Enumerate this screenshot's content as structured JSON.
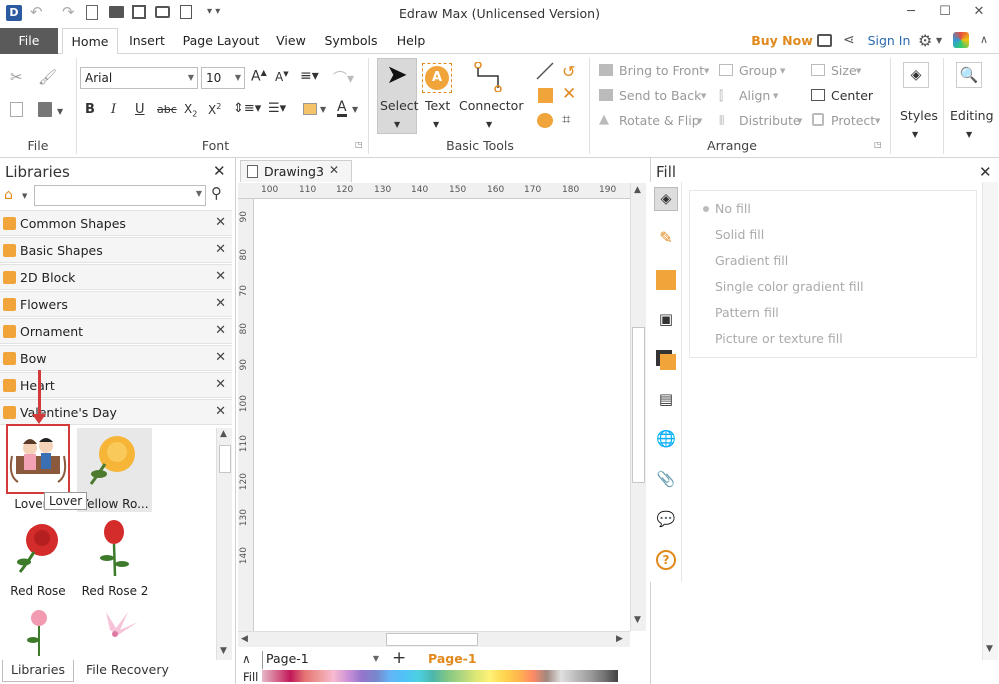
{
  "window": {
    "title": "Edraw Max (Unlicensed Version)"
  },
  "menu": {
    "file": "File",
    "tabs": [
      "Home",
      "Insert",
      "Page Layout",
      "View",
      "Symbols",
      "Help"
    ],
    "buy_now": "Buy Now",
    "sign_in": "Sign In"
  },
  "ribbon": {
    "file_group": "File",
    "font_group": "Font",
    "font_name": "Arial",
    "font_size": "10",
    "basic_tools_group": "Basic Tools",
    "select": "Select",
    "text": "Text",
    "connector": "Connector",
    "arrange_group": "Arrange",
    "bring_to_front": "Bring to Front",
    "send_to_back": "Send to Back",
    "rotate_flip": "Rotate & Flip",
    "group": "Group",
    "align": "Align",
    "distribute": "Distribute",
    "size": "Size",
    "center": "Center",
    "protect": "Protect",
    "styles": "Styles",
    "editing": "Editing"
  },
  "libraries": {
    "title": "Libraries",
    "items": [
      "Common Shapes",
      "Basic Shapes",
      "2D Block",
      "Flowers",
      "Ornament",
      "Bow",
      "Heart",
      "Valentine's Day"
    ],
    "shapes": [
      "Lover",
      "Yellow Ro...",
      "Red Rose",
      "Red Rose 2"
    ],
    "tooltip": "Lover",
    "bottom_tabs": [
      "Libraries",
      "File Recovery"
    ]
  },
  "document": {
    "tab": "Drawing3",
    "hruler": [
      "100",
      "110",
      "120",
      "130",
      "140",
      "150",
      "160",
      "170",
      "180",
      "190"
    ],
    "vruler": [
      "90",
      "80",
      "70",
      "80",
      "90",
      "100",
      "110",
      "120",
      "130",
      "140"
    ]
  },
  "fill_panel": {
    "title": "Fill",
    "options": [
      "No fill",
      "Solid fill",
      "Gradient fill",
      "Single color gradient fill",
      "Pattern fill",
      "Picture or texture fill"
    ]
  },
  "status": {
    "page_select": "Page-1",
    "page_tab": "Page-1",
    "fill_label": "Fill"
  },
  "colors": {
    "accent": "#f0a43a",
    "file_tab_bg": "#5a5a5a",
    "highlight_red": "#d33b3b"
  }
}
